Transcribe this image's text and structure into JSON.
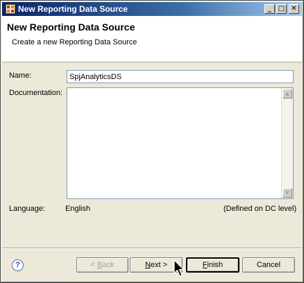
{
  "window": {
    "title": "New Reporting Data Source",
    "controls": {
      "minimize": "_",
      "maximize": "□",
      "close": "✕"
    }
  },
  "header": {
    "title": "New Reporting Data Source",
    "subtitle": "Create a new Reporting Data Source"
  },
  "form": {
    "name_label": "Name:",
    "name_value": "SpjAnalyticsDS",
    "documentation_label": "Documentation:",
    "documentation_value": "",
    "language_label": "Language:",
    "language_value": "English",
    "language_note": "(Defined on DC level)"
  },
  "scrollbar": {
    "up": "▲",
    "down": "▼"
  },
  "footer": {
    "help_icon": "?",
    "back_prefix": "< ",
    "back_mnemonic": "B",
    "back_rest": "ack",
    "next_mnemonic": "N",
    "next_rest": "ext >",
    "finish_mnemonic": "F",
    "finish_rest": "inish",
    "cancel_label": "Cancel"
  },
  "icons": {
    "title": "wizard-icon",
    "help": "help-icon",
    "cursor": "mouse-pointer-icon"
  },
  "colors": {
    "titlebar_start": "#0a246a",
    "titlebar_end": "#a6caf0",
    "dialog_bg": "#ece9d8",
    "input_border": "#7f9db9"
  }
}
